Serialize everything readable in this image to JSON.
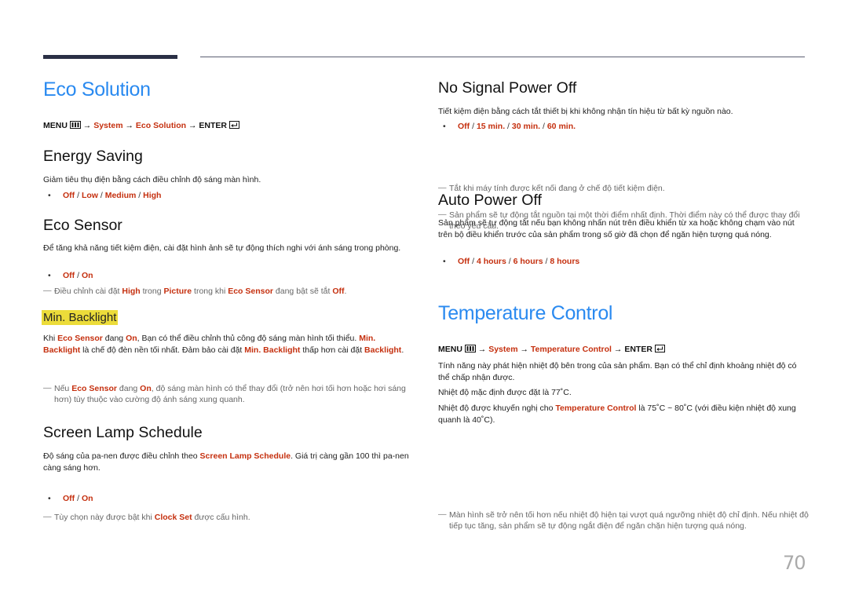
{
  "page_number": "70",
  "eco_solution": {
    "title": "Eco Solution",
    "menu_path": {
      "menu": "MENU",
      "arrow": "→",
      "system": "System",
      "item": "Eco Solution",
      "enter": "ENTER"
    },
    "energy_saving": {
      "title": "Energy Saving",
      "desc": "Giảm tiêu thụ điện bằng cách điều chỉnh độ sáng màn hình.",
      "options": [
        "Off",
        "Low",
        "Medium",
        "High"
      ]
    },
    "eco_sensor": {
      "title": "Eco Sensor",
      "desc": "Để tăng khả năng tiết kiệm điện, cài đặt hình ảnh sẽ tự động thích nghi với ánh sáng trong phòng.",
      "options": [
        "Off",
        "On"
      ],
      "note": {
        "t1": "Điều chỉnh cài đặt ",
        "b1": "High",
        "t2": " trong ",
        "b2": "Picture",
        "t3": " trong khi ",
        "b3": "Eco Sensor",
        "t4": " đang bật sẽ tắt ",
        "b4": "Off",
        "t5": "."
      }
    },
    "min_backlight": {
      "title": "Min. Backlight",
      "desc": {
        "t1": "Khi ",
        "b1": "Eco Sensor",
        "t2": " đang ",
        "b2": "On",
        "t3": ", Bạn có thể điều chỉnh thủ công độ sáng màn hình tối thiểu. ",
        "b3": "Min. Backlight",
        "t4": " là chế độ đèn nền tối nhất. Đảm bảo cài đặt ",
        "b4": "Min. Backlight",
        "t5": " thấp hơn cài đặt ",
        "b5": "Backlight",
        "t6": "."
      },
      "note": {
        "t1": "Nếu ",
        "b1": "Eco Sensor",
        "t2": " đang ",
        "b2": "On",
        "t3": ", độ sáng màn hình có thể thay đổi (trở nên hơi tối hơn hoặc hơi sáng hơn) tùy thuộc vào cường độ ánh sáng xung quanh."
      }
    },
    "screen_lamp_schedule": {
      "title": "Screen Lamp Schedule",
      "desc": {
        "t1": "Độ sáng của pa-nen được điều chỉnh theo ",
        "b1": "Screen Lamp Schedule",
        "t2": ". Giá trị càng gần 100 thì pa-nen càng sáng hơn."
      },
      "note": {
        "t1": "Tùy chọn này được bật khi ",
        "b1": "Clock Set",
        "t2": " được cấu hình."
      },
      "options": [
        "Off",
        "On"
      ]
    },
    "no_signal_power_off": {
      "title": "No Signal Power Off",
      "desc": "Tiết kiệm điện bằng cách tắt thiết bị khi không nhận tín hiệu từ bất kỳ nguồn nào.",
      "options": [
        "Off",
        "15 min.",
        "30 min.",
        "60 min."
      ],
      "notes": [
        "Tắt khi máy tính được kết nối đang ở chế độ tiết kiệm điện.",
        "Sản phẩm sẽ tự động tắt nguồn tại một thời điểm nhất định. Thời điểm này có thể được thay đổi theo yêu cầu."
      ]
    },
    "auto_power_off": {
      "title": "Auto Power Off",
      "desc": "Sản phẩm sẽ tự động tắt nếu bạn không nhấn nút trên điều khiển từ xa hoặc không chạm vào nút trên bộ điều khiển trước của sản phẩm trong số giờ đã chọn để ngăn hiện tượng quá nóng.",
      "options": [
        "Off",
        "4 hours",
        "6 hours",
        "8 hours"
      ]
    }
  },
  "temperature_control": {
    "title": "Temperature Control",
    "menu_path": {
      "menu": "MENU",
      "arrow": "→",
      "system": "System",
      "item": "Temperature Control",
      "enter": "ENTER"
    },
    "desc": "Tính năng này phát hiện nhiệt độ bên trong của sản phẩm. Bạn có thể chỉ định khoảng nhiệt độ có thể chấp nhận được.",
    "default_text": "Nhiệt độ mặc định được đặt là 77˚C.",
    "recommended": {
      "t1": "Nhiệt độ được khuyến nghị cho ",
      "b1": "Temperature Control",
      "t2": " là 75˚C ~ 80˚C (với điều kiện nhiệt độ xung quanh là 40˚C)."
    },
    "note": "Màn hình sẽ trở nên tối hơn nếu nhiệt độ hiện tại vượt quá ngưỡng nhiệt độ chỉ định. Nếu nhiệt độ tiếp tục tăng, sản phẩm sẽ tự động ngắt điện để ngăn chặn hiện tượng quá nóng."
  },
  "icons": {
    "menu": "menu-grid-icon",
    "enter": "enter-icon",
    "bullet": "•",
    "note_dash": "—",
    "slash": "/"
  }
}
